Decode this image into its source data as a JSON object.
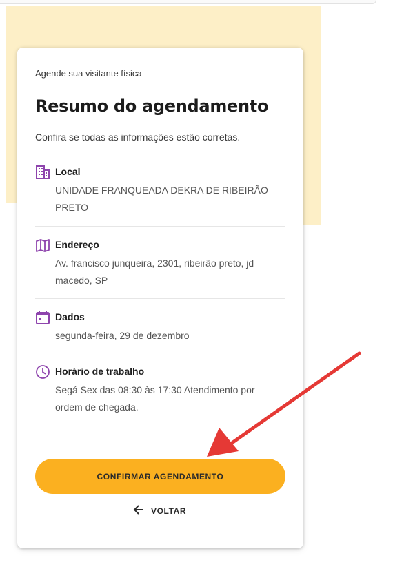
{
  "page": {
    "subtitle": "Agende sua visitante física",
    "title": "Resumo do agendamento",
    "intro": "Confira se todas as informações estão corretas."
  },
  "details": [
    {
      "icon": "building-icon",
      "label": "Local",
      "value": "UNIDADE FRANQUEADA DEKRA DE RIBEIRÃO PRETO"
    },
    {
      "icon": "map-icon",
      "label": "Endereço",
      "value": "Av. francisco junqueira, 2301, ribeirão preto, jd macedo, SP"
    },
    {
      "icon": "calendar-icon",
      "label": "Dados",
      "value": "segunda-feira, 29 de dezembro"
    },
    {
      "icon": "clock-icon",
      "label": "Horário de trabalho",
      "value": "Segá Sex das 08:30 às 17:30 Atendimento por ordem de chegada."
    }
  ],
  "actions": {
    "confirm_label": "CONFIRMAR AGENDAMENTO",
    "back_label": "VOLTAR"
  },
  "colors": {
    "accent": "#fbb020",
    "icon": "#8e44ad",
    "banner": "#fdefc7",
    "annotation_arrow": "#e53935"
  }
}
